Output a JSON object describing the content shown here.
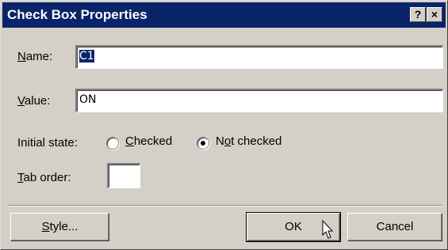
{
  "window": {
    "title": "Check Box Properties",
    "help_label": "?",
    "close_label": "×"
  },
  "fields": {
    "name": {
      "label_mn": "N",
      "label_rest": "ame:",
      "value": "C1"
    },
    "value": {
      "label_mn": "V",
      "label_rest": "alue:",
      "value": "ON"
    }
  },
  "initial_state": {
    "label": "Initial state:",
    "options": [
      {
        "pre": "",
        "mn": "C",
        "post": "hecked",
        "selected": false
      },
      {
        "pre": "N",
        "mn": "o",
        "post": "t checked",
        "selected": true
      }
    ]
  },
  "tab_order": {
    "label_mn": "T",
    "label_rest": "ab order:",
    "value": ""
  },
  "buttons": {
    "style": {
      "mn": "S",
      "rest": "tyle..."
    },
    "ok": "OK",
    "cancel": "Cancel"
  },
  "colors": {
    "title_bar": "#0a246a",
    "face": "#d4d0c8"
  }
}
